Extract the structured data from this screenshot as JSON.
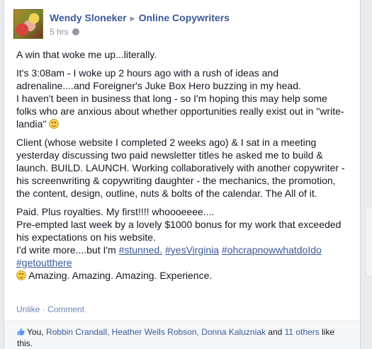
{
  "post": {
    "author": "Wendy Sloneker",
    "group": "Online Copywriters",
    "time": "5 hrs",
    "paragraphs": {
      "p1": "A win that woke me up...literally.",
      "p2": [
        "It's 3:08am - I woke up 2 hours ago with a rush of ideas and adrenaline....and Foreigner's Juke Box Hero buzzing in my head.",
        "I haven't been in business that long - so I'm hoping this may help some folks who are anxious about whether opportunities really exist out in \"write-landia\""
      ],
      "p3": "Client (whose website I completed 2 weeks ago) & I sat in a meeting yesterday discussing two paid newsletter titles he asked me to build & launch. BUILD. LAUNCH. Working collaboratively with another copywriter - his screenwriting & copywriting daughter - the mechanics, the promotion, the content, design, outline, nuts & bolts of the calendar. The All of it.",
      "p4": {
        "line1": "Paid. Plus royalties. My first!!!! whoooeeee....",
        "line2": "Pre-empted last week by a lovely $1000 bonus for my work that exceeded his expectations on his website.",
        "line3_prefix": "I'd write more....but I'm",
        "hashtags": [
          "#stunned.",
          "#yesVirginia",
          "#ohcrapnowwhatdoIdo",
          "#getoutthere"
        ],
        "closing": "Amazing. Amazing. Amazing. Experience."
      }
    },
    "actions": {
      "unlike": "Unlike",
      "separator": "·",
      "comment": "Comment"
    },
    "likes": {
      "prefix": "You,",
      "names": [
        "Robbin Crandall,",
        "Heather Wells Robson,",
        "Donna Kaluzniak"
      ],
      "and": "and",
      "others": "11 others",
      "suffix": "like this."
    }
  },
  "colors": {
    "link": "#3b5998",
    "meta": "#90949c",
    "text": "#141823",
    "background": "#e9ebee"
  }
}
